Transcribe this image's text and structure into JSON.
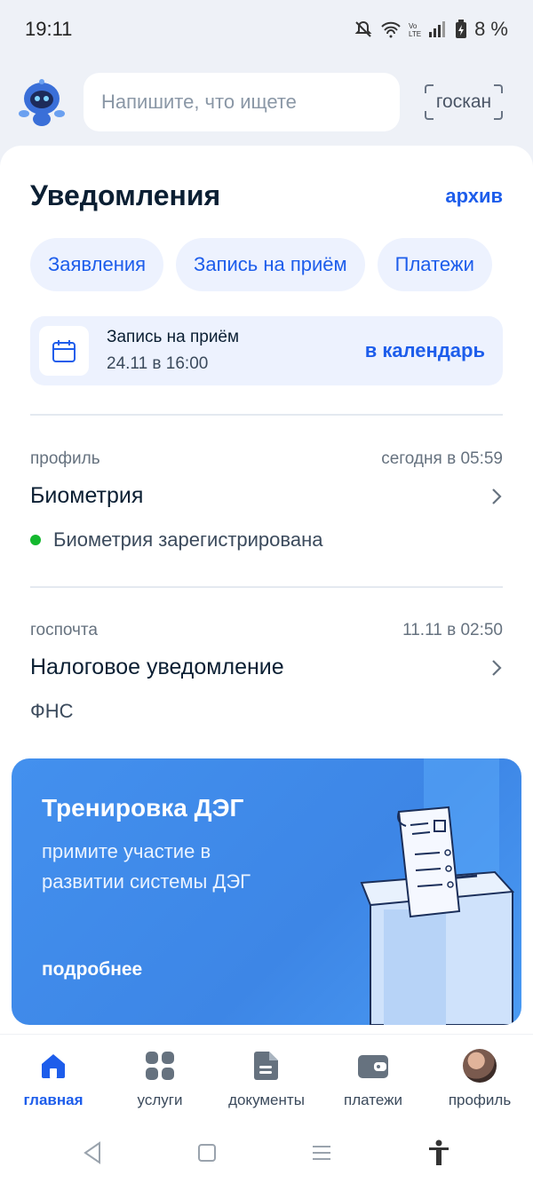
{
  "status_bar": {
    "time": "19:11",
    "battery": "8 %"
  },
  "header": {
    "search_placeholder": "Напишите, что ищете",
    "goscan_label": "госкан"
  },
  "notifications": {
    "title": "Уведомления",
    "archive_label": "архив",
    "filters": [
      "Заявления",
      "Запись на приём",
      "Платежи"
    ],
    "appointment": {
      "title": "Запись на приём",
      "time": "24.11 в 16:00",
      "link": "в календарь"
    },
    "items": [
      {
        "category": "профиль",
        "date": "сегодня в 05:59",
        "title": "Биометрия",
        "subtitle": "Биометрия зарегистрирована",
        "status_color": "#14b82e"
      },
      {
        "category": "госпочта",
        "date": "11.11 в 02:50",
        "title": "Налоговое уведомление",
        "subtitle": "ФНС"
      }
    ]
  },
  "banner": {
    "title": "Тренировка ДЭГ",
    "text": "примите участие в развитии системы ДЭГ",
    "link": "подробнее"
  },
  "bottom_nav": {
    "items": [
      {
        "label": "главная",
        "icon": "home-icon",
        "active": true
      },
      {
        "label": "услуги",
        "icon": "grid-icon"
      },
      {
        "label": "документы",
        "icon": "document-icon"
      },
      {
        "label": "платежи",
        "icon": "wallet-icon"
      },
      {
        "label": "профиль",
        "icon": "avatar"
      }
    ]
  },
  "colors": {
    "accent": "#1d5deb",
    "chip_bg": "#edf2fe",
    "banner": "#4390ee"
  }
}
